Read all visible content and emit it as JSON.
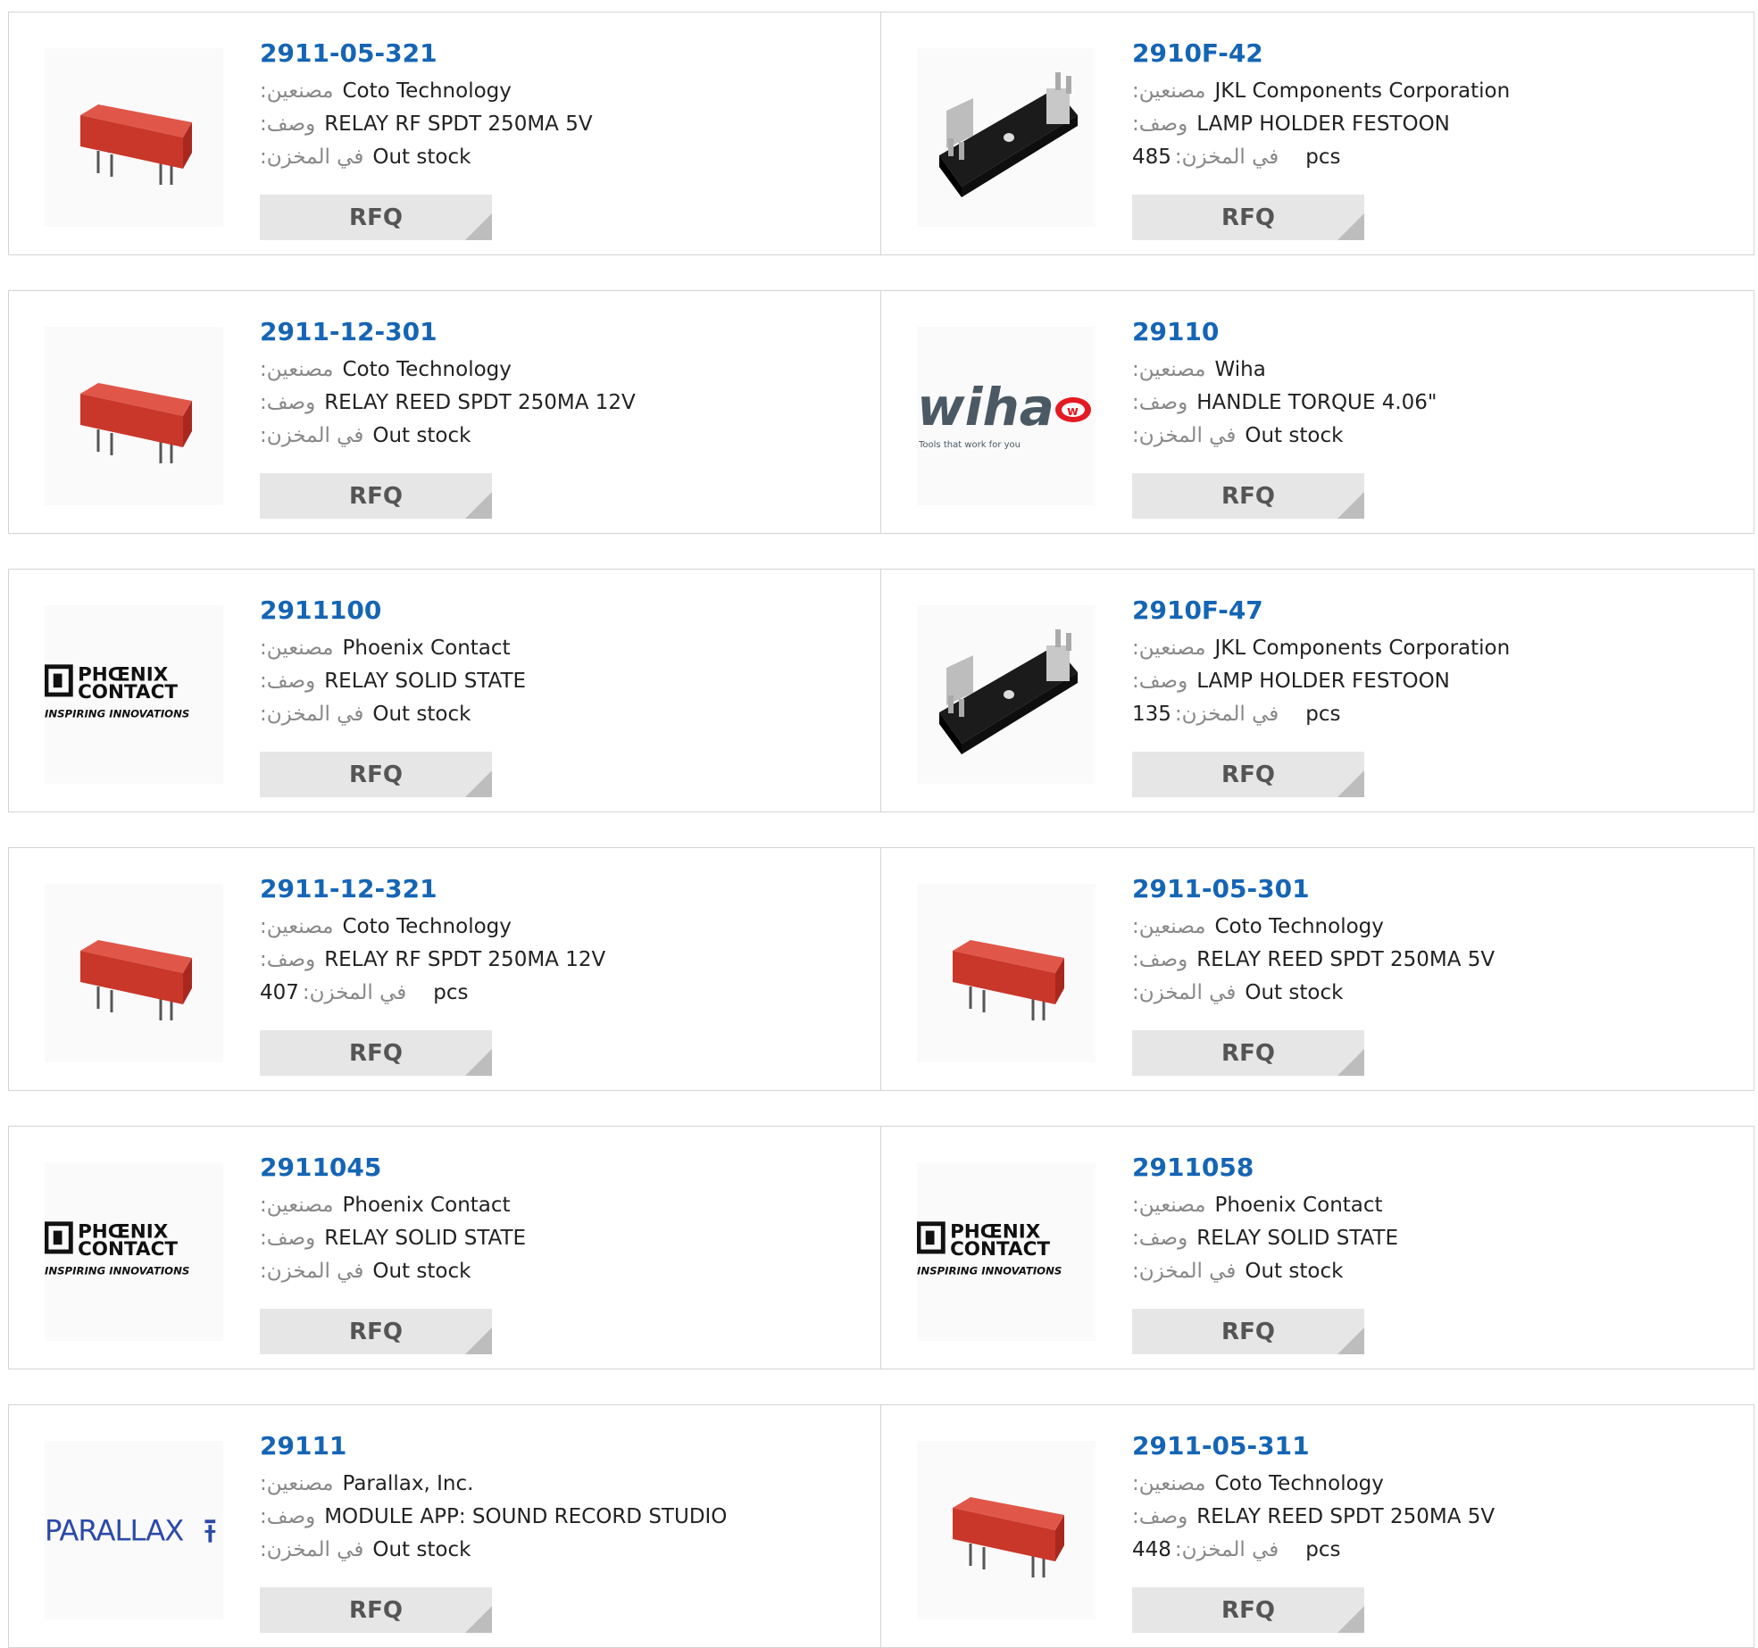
{
  "labels": {
    "manufacturer": "مصنعين:",
    "description": "وصف:",
    "stock": "في المخزن:",
    "rfq": "RFQ",
    "pcs": "pcs"
  },
  "products": [
    {
      "part": "2911-05-321",
      "manufacturer": "Coto Technology",
      "description": "RELAY RF SPDT 250MA 5V",
      "stock": "Out stock",
      "in_stock": false,
      "image": "red-reed-relay-image"
    },
    {
      "part": "2910F-42",
      "manufacturer": "JKL Components Corporation",
      "description": "LAMP HOLDER FESTOON",
      "stock": "485",
      "in_stock": true,
      "image": "black-lamp-holder-image"
    },
    {
      "part": "2911-12-301",
      "manufacturer": "Coto Technology",
      "description": "RELAY REED SPDT 250MA 12V",
      "stock": "Out stock",
      "in_stock": false,
      "image": "red-reed-relay-image"
    },
    {
      "part": "29110",
      "manufacturer": "Wiha",
      "description": "HANDLE TORQUE 4.06\"",
      "stock": "Out stock",
      "in_stock": false,
      "image": "wiha-logo",
      "logo_text": "wiha",
      "logo_tagline": "Tools that work for you"
    },
    {
      "part": "2911100",
      "manufacturer": "Phoenix Contact",
      "description": "RELAY SOLID STATE",
      "stock": "Out stock",
      "in_stock": false,
      "image": "phoenix-contact-logo",
      "logo_text": "PHŒNIX CONTACT",
      "logo_tagline": "INSPIRING INNOVATIONS"
    },
    {
      "part": "2910F-47",
      "manufacturer": "JKL Components Corporation",
      "description": "LAMP HOLDER FESTOON",
      "stock": "135",
      "in_stock": true,
      "image": "black-lamp-holder-image"
    },
    {
      "part": "2911-12-321",
      "manufacturer": "Coto Technology",
      "description": "RELAY RF SPDT 250MA 12V",
      "stock": "407",
      "in_stock": true,
      "image": "red-reed-relay-image"
    },
    {
      "part": "2911-05-301",
      "manufacturer": "Coto Technology",
      "description": "RELAY REED SPDT 250MA 5V",
      "stock": "Out stock",
      "in_stock": false,
      "image": "red-reed-relay-image"
    },
    {
      "part": "2911045",
      "manufacturer": "Phoenix Contact",
      "description": "RELAY SOLID STATE",
      "stock": "Out stock",
      "in_stock": false,
      "image": "phoenix-contact-logo",
      "logo_text": "PHŒNIX CONTACT",
      "logo_tagline": "INSPIRING INNOVATIONS"
    },
    {
      "part": "2911058",
      "manufacturer": "Phoenix Contact",
      "description": "RELAY SOLID STATE",
      "stock": "Out stock",
      "in_stock": false,
      "image": "phoenix-contact-logo",
      "logo_text": "PHŒNIX CONTACT",
      "logo_tagline": "INSPIRING INNOVATIONS"
    },
    {
      "part": "29111",
      "manufacturer": "Parallax, Inc.",
      "description": "MODULE APP: SOUND RECORD STUDIO",
      "stock": "Out stock",
      "in_stock": false,
      "image": "parallax-logo",
      "logo_text": "PARALLAX"
    },
    {
      "part": "2911-05-311",
      "manufacturer": "Coto Technology",
      "description": "RELAY REED SPDT 250MA 5V",
      "stock": "448",
      "in_stock": true,
      "image": "red-reed-relay-image"
    }
  ],
  "colors": {
    "link": "#1565b5",
    "relay_red": "#c9362a",
    "border": "#d4d4d4",
    "rfq_bg": "#e6e6e6"
  }
}
